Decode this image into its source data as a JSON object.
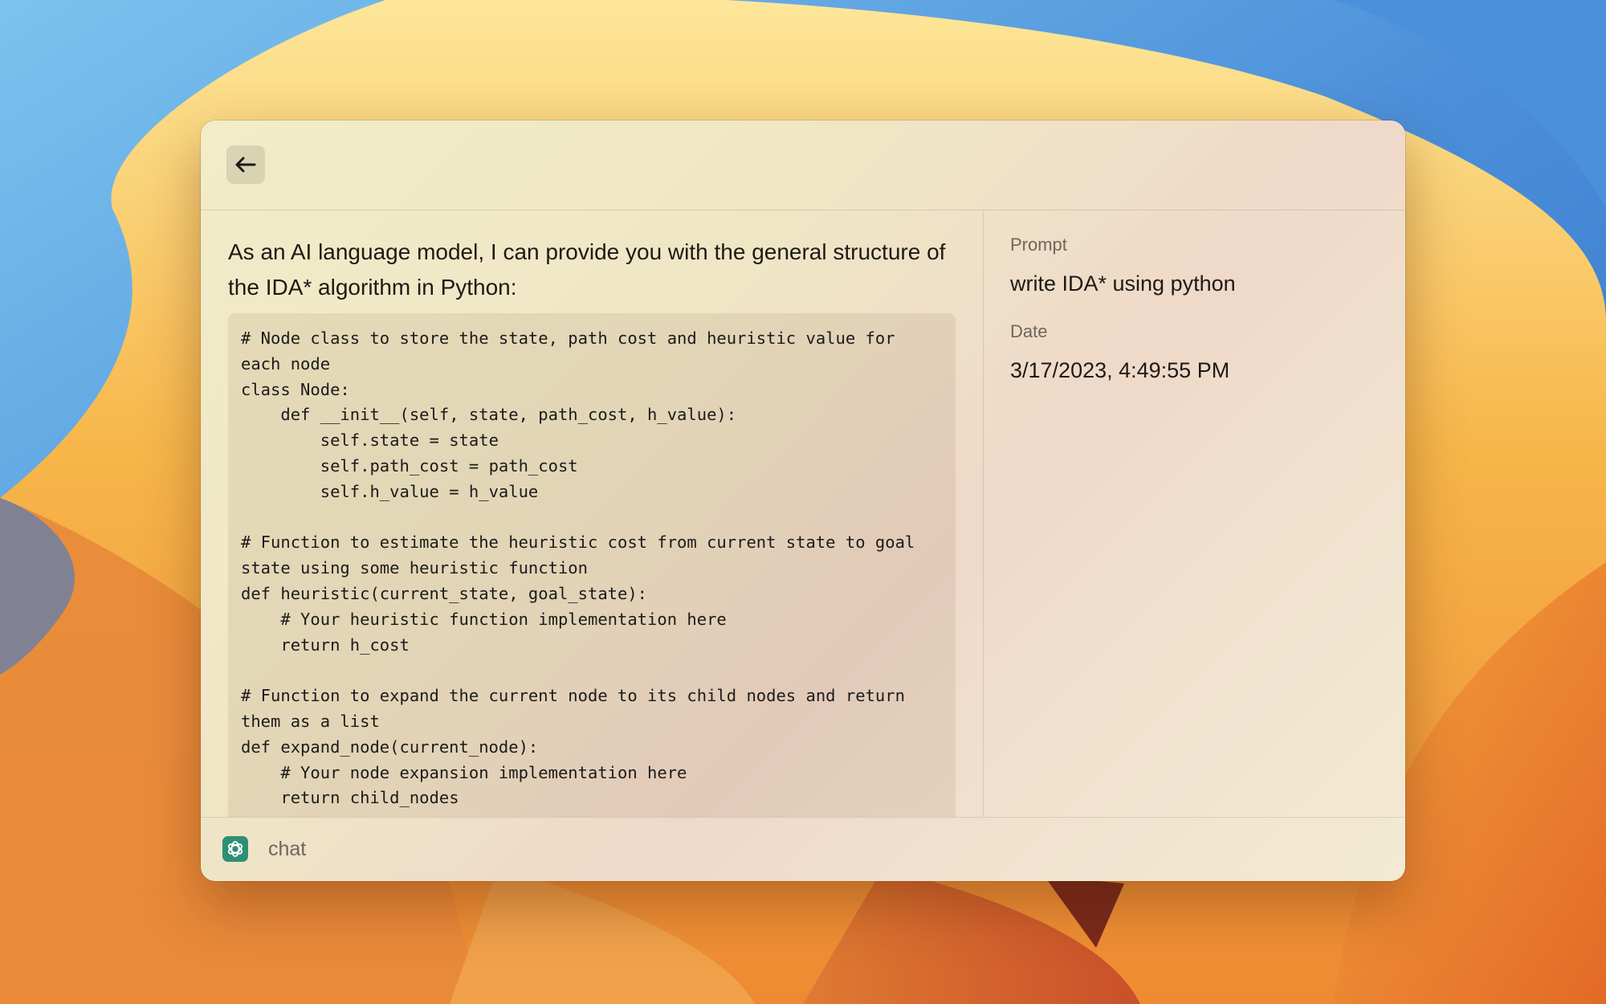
{
  "window": {
    "back_icon": "arrow-left-icon"
  },
  "response": {
    "intro": "As an AI language model, I can provide you with the general structure of the IDA* algorithm in Python:",
    "code": "# Node class to store the state, path cost and heuristic value for each node\nclass Node:\n    def __init__(self, state, path_cost, h_value):\n        self.state = state\n        self.path_cost = path_cost\n        self.h_value = h_value\n\n# Function to estimate the heuristic cost from current state to goal state using some heuristic function\ndef heuristic(current_state, goal_state):\n    # Your heuristic function implementation here\n    return h_cost\n\n# Function to expand the current node to its child nodes and return them as a list\ndef expand_node(current_node):\n    # Your node expansion implementation here\n    return child_nodes"
  },
  "details": {
    "prompt_label": "Prompt",
    "prompt_value": "write IDA* using python",
    "date_label": "Date",
    "date_value": "3/17/2023, 4:49:55 PM"
  },
  "footer": {
    "app_icon": "chatgpt-logo-icon",
    "label": "chat"
  }
}
